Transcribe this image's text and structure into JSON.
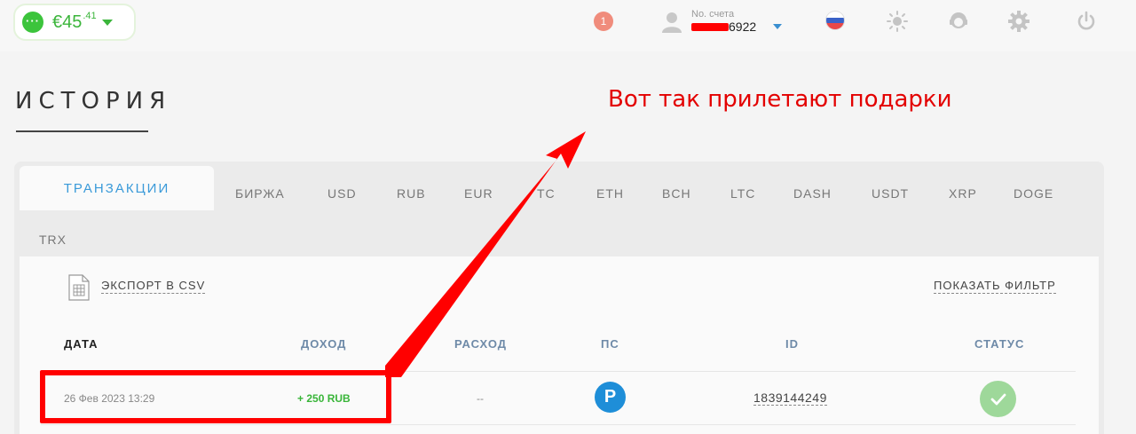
{
  "header": {
    "balance": {
      "currency": "€",
      "amount": "45",
      "cents": ".41"
    },
    "notifications_count": "1",
    "account": {
      "label": "No. счета",
      "number_visible": "6922"
    },
    "colors": {
      "accent_green": "#3bb53b",
      "link_blue": "#3a9ad9",
      "notif": "#f08c7c"
    }
  },
  "page": {
    "title": "ИСТОРИЯ"
  },
  "annotation": {
    "text": "Вот так прилетают подарки",
    "color": "#e30000"
  },
  "tabs": {
    "active": "ТРАНЗАКЦИИ",
    "items": [
      "БИРЖА",
      "USD",
      "RUB",
      "EUR",
      "TC",
      "ETH",
      "BCH",
      "LTC",
      "DASH",
      "USDT",
      "XRP",
      "DOGE"
    ],
    "row2": "TRX"
  },
  "actions": {
    "export_csv": "ЭКСПОРТ В CSV",
    "show_filter": "ПОКАЗАТЬ ФИЛЬТР"
  },
  "table": {
    "headers": {
      "date": "ДАТА",
      "income": "ДОХОД",
      "expense": "РАСХОД",
      "ps": "ПС",
      "id": "ID",
      "status": "СТАТУС"
    },
    "rows": [
      {
        "date": "26 Фев 2023 13:29",
        "income": "+ 250 RUB",
        "expense": "--",
        "ps_icon_letter": "P",
        "id": "1839144249",
        "status": "check"
      }
    ]
  }
}
